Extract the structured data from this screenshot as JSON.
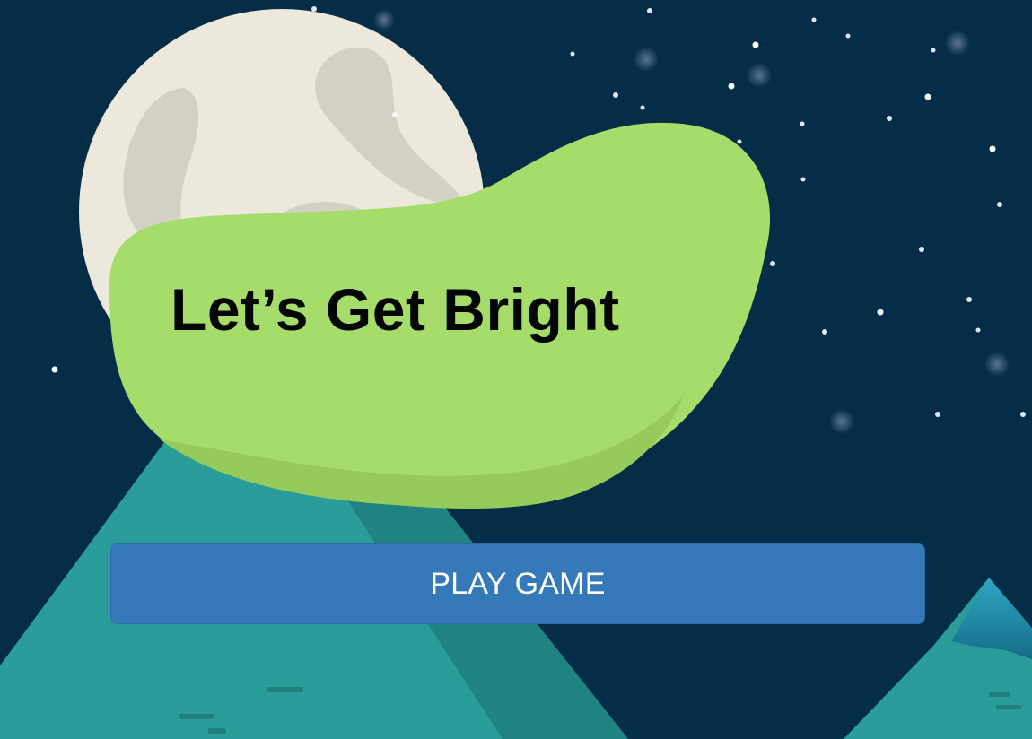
{
  "game": {
    "title": "Let’s Get Bright",
    "play_button_label": "PLAY GAME"
  },
  "theme": {
    "sky_color": "#062d48",
    "moon_color": "#ece8dc",
    "blob_color": "#a6dc69",
    "mountain_color": "#2a9d9a",
    "button_color": "#3679b9",
    "button_text_color": "#ffffff",
    "title_color": "#050505"
  }
}
